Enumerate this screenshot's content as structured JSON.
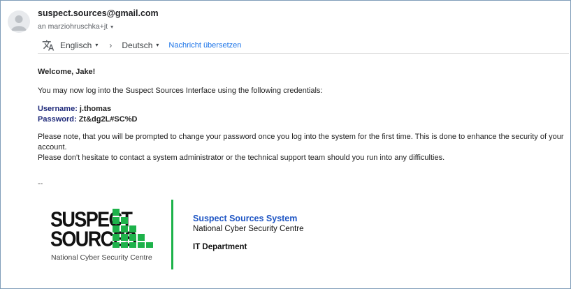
{
  "sender": {
    "email": "suspect.sources@gmail.com",
    "recipient": "an marziohruschka+jt",
    "recipient_caret": "▾"
  },
  "translate": {
    "source_lang": "Englisch",
    "target_lang": "Deutsch",
    "caret": "▾",
    "chevron": "›",
    "translate_link": "Nachricht übersetzen"
  },
  "message": {
    "greeting": "Welcome, Jake!",
    "intro": "You may now log into the Suspect Sources Interface using the following credentials:",
    "username_label": "Username:",
    "username_value": "j.thomas",
    "password_label": "Password:",
    "password_value": "Zt&dg2L#SC%D",
    "note_line1": "Please note, that you will be prompted to change your password once you log into the system for the first time. This is done to enhance the security of your account.",
    "note_line2": "Please don't hesitate to contact a system administrator or the technical support team should you run into any difficulties.",
    "sig_separator": "--"
  },
  "signature": {
    "logo_line1": "SUSPECT",
    "logo_line2": "SOURCES",
    "logo_tagline": "National Cyber Security Centre",
    "system_name": "Suspect Sources System",
    "organization": "National Cyber Security Centre",
    "department": "IT Department"
  },
  "colors": {
    "accent_green": "#1db24a",
    "link_blue": "#1a73e8",
    "credential_label": "#1f2a7a",
    "system_name_blue": "#1f56c4"
  },
  "icons": {
    "avatar": "default-avatar-icon",
    "translate": "translate-icon",
    "chevron": "chevron-right-icon",
    "caret": "caret-down-icon"
  }
}
